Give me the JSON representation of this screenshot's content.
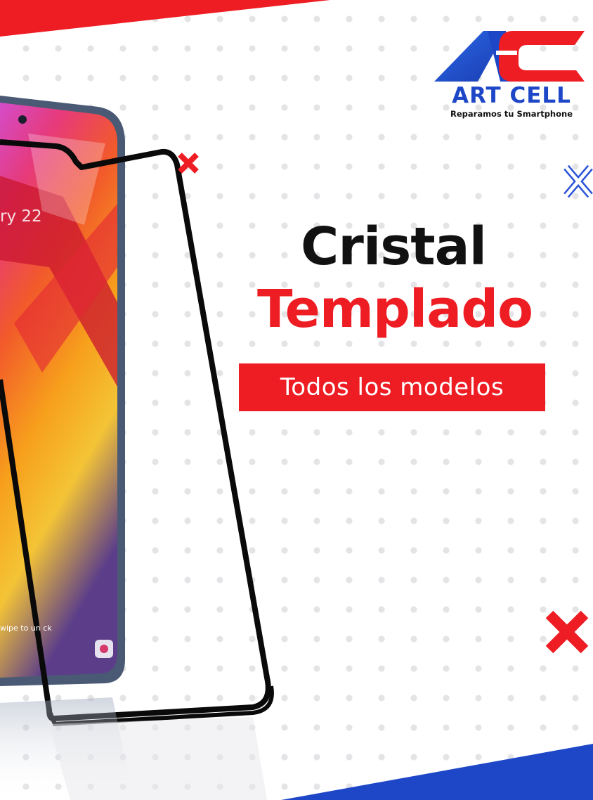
{
  "brand": {
    "name": "ART CELL",
    "tagline": "Reparamos tu Smartphone",
    "colors": {
      "blue": "#1e47c8",
      "red": "#ee1d23",
      "dark": "#111111"
    }
  },
  "headline": {
    "line1": "Cristal",
    "line2": "Templado"
  },
  "banner": {
    "text": "Todos los modelos"
  },
  "phone_screen": {
    "date_fragment": "ry 22",
    "unlock_text": "wipe to un ck"
  },
  "decorations": {
    "icons": [
      "x-mark-red-small-icon",
      "x-mark-blue-outline-icon",
      "x-mark-red-large-icon"
    ]
  }
}
